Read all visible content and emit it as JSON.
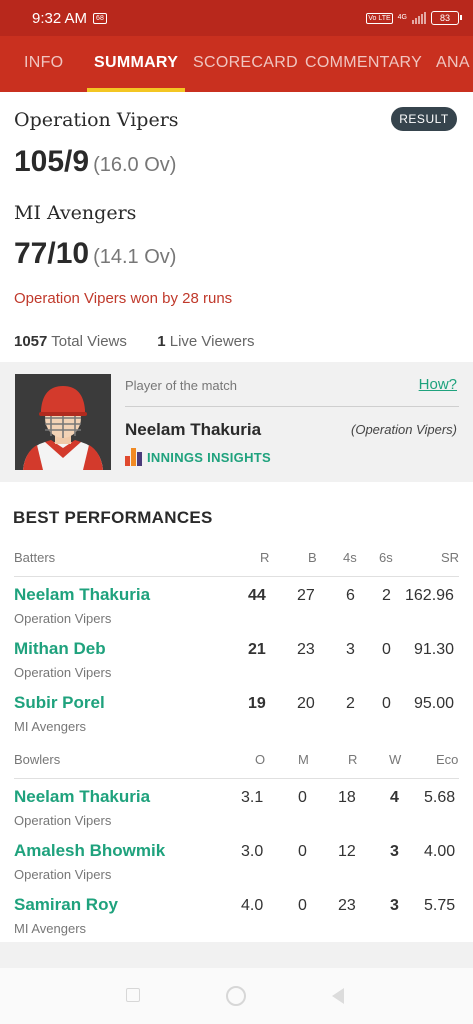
{
  "status_bar": {
    "time": "9:32 AM",
    "battery": "83",
    "network": "4G",
    "volte": "Vo LTE"
  },
  "tabs": [
    "INFO",
    "SUMMARY",
    "SCORECARD",
    "COMMENTARY",
    "ANA"
  ],
  "active_tab": "SUMMARY",
  "result_button": "RESULT",
  "teams": [
    {
      "name": "Operation Vipers",
      "score": "105/9",
      "overs": "(16.0 Ov)"
    },
    {
      "name": "MI Avengers",
      "score": "77/10",
      "overs": "(14.1 Ov)"
    }
  ],
  "result_text": "Operation Vipers won by 28 runs",
  "views": {
    "total_count": "1057",
    "total_label": "Total Views",
    "live_count": "1",
    "live_label": "Live Viewers"
  },
  "player_of_match": {
    "label": "Player of the match",
    "how_link": "How?",
    "name": "Neelam Thakuria",
    "team": "(Operation Vipers)",
    "insights_label": "INNINGS INSIGHTS"
  },
  "best_performances": {
    "title": "BEST PERFORMANCES",
    "batters_header": {
      "label": "Batters",
      "cols": [
        "R",
        "B",
        "4s",
        "6s",
        "SR"
      ]
    },
    "batters": [
      {
        "name": "Neelam Thakuria",
        "team": "Operation Vipers",
        "r": "44",
        "b": "27",
        "fours": "6",
        "sixes": "2",
        "sr": "162.96"
      },
      {
        "name": "Mithan Deb",
        "team": "Operation Vipers",
        "r": "21",
        "b": "23",
        "fours": "3",
        "sixes": "0",
        "sr": "91.30"
      },
      {
        "name": "Subir Porel",
        "team": "MI Avengers",
        "r": "19",
        "b": "20",
        "fours": "2",
        "sixes": "0",
        "sr": "95.00"
      }
    ],
    "bowlers_header": {
      "label": "Bowlers",
      "cols": [
        "O",
        "M",
        "R",
        "W",
        "Eco"
      ]
    },
    "bowlers": [
      {
        "name": "Neelam Thakuria",
        "team": "Operation Vipers",
        "o": "3.1",
        "m": "0",
        "r": "18",
        "w": "4",
        "eco": "5.68"
      },
      {
        "name": "Amalesh Bhowmik",
        "team": "Operation Vipers",
        "o": "3.0",
        "m": "0",
        "r": "12",
        "w": "3",
        "eco": "4.00"
      },
      {
        "name": "Samiran Roy",
        "team": "MI Avengers",
        "o": "4.0",
        "m": "0",
        "r": "23",
        "w": "3",
        "eco": "5.75"
      }
    ]
  },
  "colors": {
    "header": "#c9301f",
    "status": "#b8281c",
    "indicator": "#f3c623",
    "accent": "#1fa27d",
    "result": "#c0392b"
  },
  "icons": [
    "sim-icon",
    "signal-icon",
    "battery-icon",
    "player-avatar",
    "insights-bars-icon",
    "nav-recents-icon",
    "nav-home-icon",
    "nav-back-icon"
  ]
}
